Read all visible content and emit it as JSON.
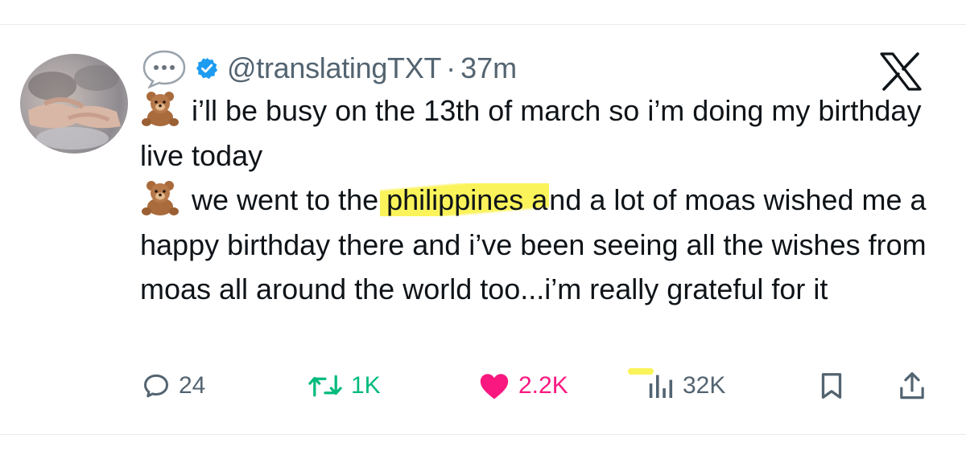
{
  "tweet": {
    "handle": "@translatingTXT",
    "separator": "·",
    "time": "37m",
    "paragraphs": [
      {
        "emoji": "teddy-bear",
        "text": "i’ll be busy on the 13th of march so i’m doing my birthday live today"
      },
      {
        "emoji": "teddy-bear",
        "before": "we went to the",
        "highlight": "philippines a",
        "after": "nd a lot of moas wished me a happy birthday there and i’ve been seeing all the wishes from moas all around the world too...i’m really grateful for it"
      }
    ]
  },
  "metrics": {
    "replies": "24",
    "retweets": "1K",
    "likes": "2.2K",
    "views": "32K"
  },
  "colors": {
    "text": "#0f1419",
    "muted": "#536471",
    "verified": "#1d9bf0",
    "retweet": "#00ba7c",
    "like": "#f91880",
    "highlight": "#fbf35a"
  },
  "icons": [
    "speech-bubble-icon",
    "verified-badge-icon",
    "x-logo-icon",
    "teddy-bear-icon",
    "reply-icon",
    "retweet-icon",
    "heart-icon",
    "views-icon",
    "bookmark-icon",
    "share-icon"
  ]
}
